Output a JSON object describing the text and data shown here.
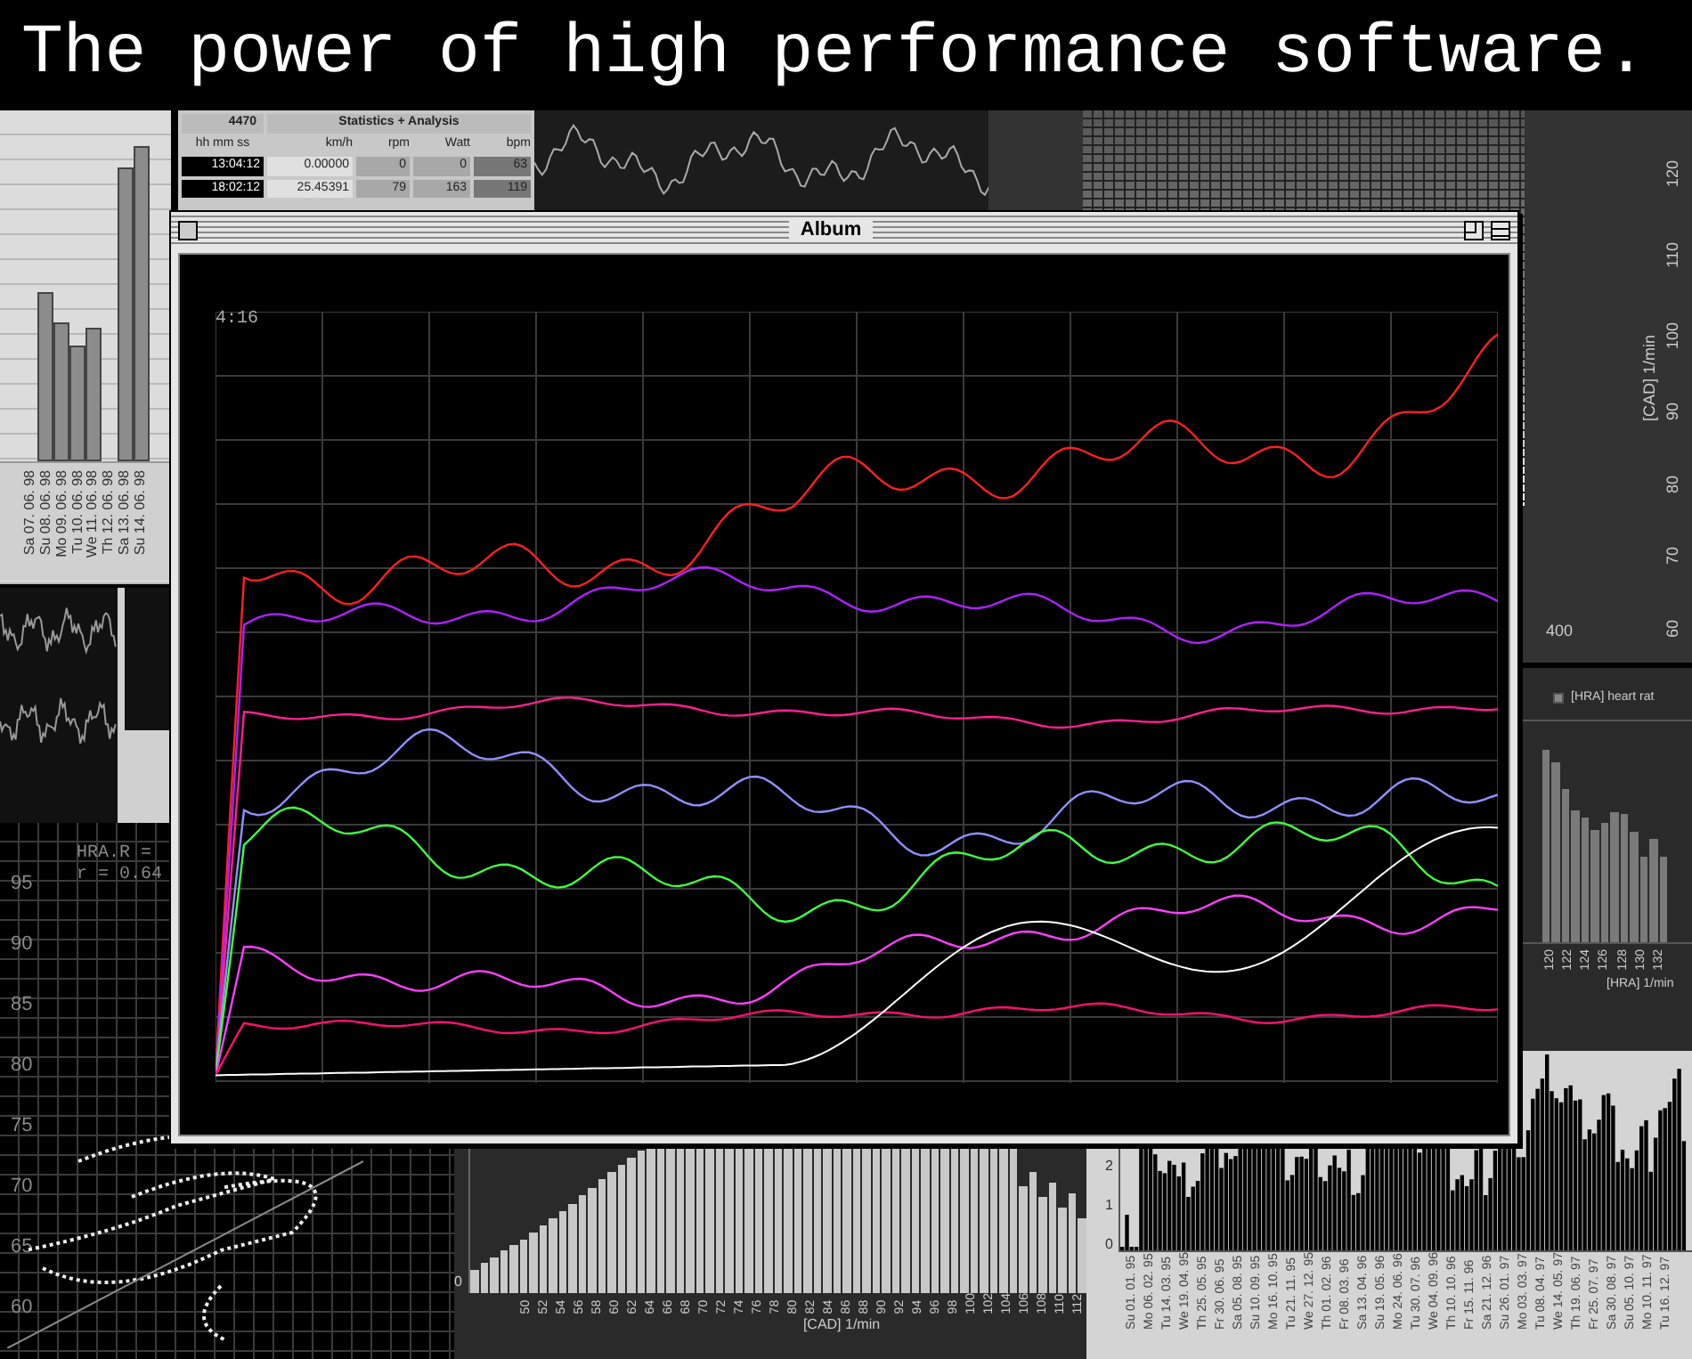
{
  "headline": "The power of high performance software.",
  "weekly_chart": {
    "labels": [
      "Sa 07. 06. 98",
      "Su 08. 06. 98",
      "Mo 09. 06. 98",
      "Tu 10. 06. 98",
      "We 11. 06. 98",
      "Th 12. 06. 98",
      "Sa 13. 06. 98",
      "Su 14. 06. 98"
    ]
  },
  "stats_table": {
    "id": "4470",
    "title": "Statistics + Analysis",
    "columns": [
      "hh mm ss",
      "km/h",
      "rpm",
      "Watt",
      "bpm"
    ],
    "rows": [
      [
        "13:04:12",
        "0.00000",
        "0",
        "0",
        "63"
      ],
      [
        "18:02:12",
        "25.45391",
        "79",
        "163",
        "119"
      ]
    ]
  },
  "surface_chart": {
    "y_labels": [
      "120",
      "110",
      "100",
      "90",
      "80",
      "70",
      "60"
    ],
    "axis_label": "[CAD] 1/min",
    "x_label": "400"
  },
  "hra_chart": {
    "legend": "[HRA] heart rat",
    "x_labels": [
      "120",
      "122",
      "124",
      "126",
      "128",
      "130",
      "132"
    ],
    "axis_label": "[HRA] 1/min"
  },
  "scatter_chart": {
    "formula": "HRA.R = ",
    "correlation": "r = 0.64",
    "y_labels": [
      "95",
      "90",
      "85",
      "80",
      "75",
      "70",
      "65",
      "60"
    ]
  },
  "cad_histogram": {
    "zero_label": "0",
    "x_labels": [
      "50",
      "52",
      "54",
      "56",
      "58",
      "60",
      "62",
      "64",
      "66",
      "68",
      "70",
      "72",
      "74",
      "76",
      "78",
      "80",
      "82",
      "84",
      "86",
      "88",
      "90",
      "92",
      "94",
      "96",
      "98",
      "100",
      "102",
      "104",
      "106",
      "108",
      "110",
      "112"
    ],
    "axis_label": "[CAD] 1/min"
  },
  "daily_chart": {
    "y_labels": [
      "2",
      "1",
      "0"
    ],
    "x_labels": [
      "Su 01. 01. 95",
      "Mo 06. 02. 95",
      "Tu 14. 03. 95",
      "We 19. 04. 95",
      "Th 25. 05. 95",
      "Fr 30. 06. 95",
      "Sa 05. 08. 95",
      "Su 10. 09. 95",
      "Mo 16. 10. 95",
      "Tu 21. 11. 95",
      "We 27. 12. 95",
      "Th 01. 02. 96",
      "Fr 08. 03. 96",
      "Sa 13. 04. 96",
      "Su 19. 05. 96",
      "Mo 24. 06. 96",
      "Tu 30. 07. 96",
      "We 04. 09. 96",
      "Th 10. 10. 96",
      "Fr 15. 11. 96",
      "Sa 21. 12. 96",
      "Su 26. 01. 97",
      "Mo 03. 03. 97",
      "Tu 08. 04. 97",
      "We 14. 05. 97",
      "Th 19. 06. 97",
      "Fr 25. 07. 97",
      "Sa 30. 08. 97",
      "Su 05. 10. 97",
      "Mo 10. 11. 97",
      "Tu 16. 12. 97"
    ]
  },
  "album_window": {
    "title": "Album",
    "time_label": "4:16"
  }
}
